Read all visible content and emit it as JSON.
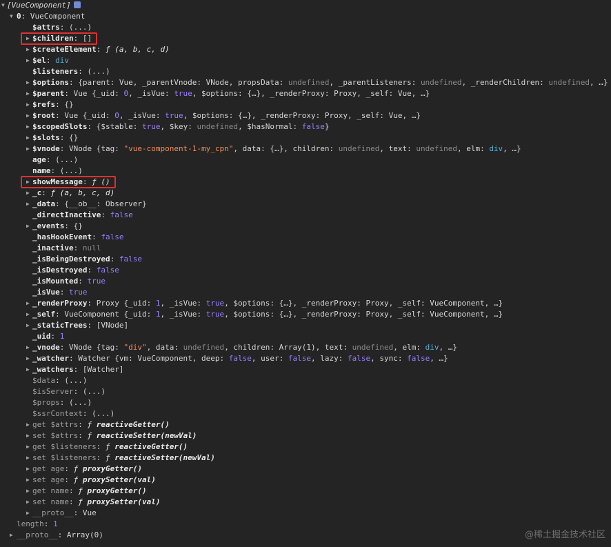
{
  "console": {
    "watermark": "@稀土掘金技术社区",
    "rows": [
      {
        "indent": 0,
        "arrow": "down",
        "parts": [
          {
            "t": "[VueComponent]",
            "c": "italic"
          },
          {
            "t": "",
            "c": "badge"
          }
        ]
      },
      {
        "indent": 1,
        "arrow": "down",
        "parts": [
          {
            "t": "0",
            "c": "k-own"
          },
          {
            "t": ": VueComponent",
            "c": ""
          }
        ]
      },
      {
        "indent": 2,
        "arrow": "",
        "parts": [
          {
            "t": "$attrs",
            "c": "k-own"
          },
          {
            "t": ": (...)",
            "c": ""
          }
        ]
      },
      {
        "indent": 2,
        "arrow": "right",
        "hl": "children",
        "parts": [
          {
            "t": "$children",
            "c": "k-own"
          },
          {
            "t": ": []",
            "c": ""
          }
        ]
      },
      {
        "indent": 2,
        "arrow": "right",
        "parts": [
          {
            "t": "$createElement",
            "c": "k-own"
          },
          {
            "t": ": ",
            "c": ""
          },
          {
            "t": "ƒ (a, b, c, d)",
            "c": "v-fn"
          }
        ]
      },
      {
        "indent": 2,
        "arrow": "right",
        "parts": [
          {
            "t": "$el",
            "c": "k-own"
          },
          {
            "t": ": ",
            "c": ""
          },
          {
            "t": "div",
            "c": "v-tag"
          }
        ]
      },
      {
        "indent": 2,
        "arrow": "",
        "parts": [
          {
            "t": "$listeners",
            "c": "k-own"
          },
          {
            "t": ": (...)",
            "c": ""
          }
        ]
      },
      {
        "indent": 2,
        "arrow": "right",
        "parts": [
          {
            "t": "$options",
            "c": "k-own"
          },
          {
            "t": ": {parent: Vue, _parentVnode: VNode, propsData: ",
            "c": ""
          },
          {
            "t": "undefined",
            "c": "v-undef"
          },
          {
            "t": ", _parentListeners: ",
            "c": ""
          },
          {
            "t": "undefined",
            "c": "v-undef"
          },
          {
            "t": ", _renderChildren: ",
            "c": ""
          },
          {
            "t": "undefined",
            "c": "v-undef"
          },
          {
            "t": ", …}",
            "c": ""
          }
        ]
      },
      {
        "indent": 2,
        "arrow": "right",
        "parts": [
          {
            "t": "$parent",
            "c": "k-own"
          },
          {
            "t": ": Vue {_uid: ",
            "c": ""
          },
          {
            "t": "0",
            "c": "v-num"
          },
          {
            "t": ", _isVue: ",
            "c": ""
          },
          {
            "t": "true",
            "c": "v-bool"
          },
          {
            "t": ", $options: {…}, _renderProxy: Proxy, _self: Vue, …}",
            "c": ""
          }
        ]
      },
      {
        "indent": 2,
        "arrow": "right",
        "parts": [
          {
            "t": "$refs",
            "c": "k-own"
          },
          {
            "t": ": {}",
            "c": ""
          }
        ]
      },
      {
        "indent": 2,
        "arrow": "right",
        "parts": [
          {
            "t": "$root",
            "c": "k-own"
          },
          {
            "t": ": Vue {_uid: ",
            "c": ""
          },
          {
            "t": "0",
            "c": "v-num"
          },
          {
            "t": ", _isVue: ",
            "c": ""
          },
          {
            "t": "true",
            "c": "v-bool"
          },
          {
            "t": ", $options: {…}, _renderProxy: Proxy, _self: Vue, …}",
            "c": ""
          }
        ]
      },
      {
        "indent": 2,
        "arrow": "right",
        "parts": [
          {
            "t": "$scopedSlots",
            "c": "k-own"
          },
          {
            "t": ": {$stable: ",
            "c": ""
          },
          {
            "t": "true",
            "c": "v-bool"
          },
          {
            "t": ", $key: ",
            "c": ""
          },
          {
            "t": "undefined",
            "c": "v-undef"
          },
          {
            "t": ", $hasNormal: ",
            "c": ""
          },
          {
            "t": "false",
            "c": "v-bool"
          },
          {
            "t": "}",
            "c": ""
          }
        ]
      },
      {
        "indent": 2,
        "arrow": "right",
        "parts": [
          {
            "t": "$slots",
            "c": "k-own"
          },
          {
            "t": ": {}",
            "c": ""
          }
        ]
      },
      {
        "indent": 2,
        "arrow": "right",
        "parts": [
          {
            "t": "$vnode",
            "c": "k-own"
          },
          {
            "t": ": VNode {tag: ",
            "c": ""
          },
          {
            "t": "\"vue-component-1-my_cpn\"",
            "c": "v-str"
          },
          {
            "t": ", data: {…}, children: ",
            "c": ""
          },
          {
            "t": "undefined",
            "c": "v-undef"
          },
          {
            "t": ", text: ",
            "c": ""
          },
          {
            "t": "undefined",
            "c": "v-undef"
          },
          {
            "t": ", elm: ",
            "c": ""
          },
          {
            "t": "div",
            "c": "v-tag"
          },
          {
            "t": ", …}",
            "c": ""
          }
        ]
      },
      {
        "indent": 2,
        "arrow": "",
        "parts": [
          {
            "t": "age",
            "c": "k-own"
          },
          {
            "t": ": (...)",
            "c": ""
          }
        ]
      },
      {
        "indent": 2,
        "arrow": "",
        "parts": [
          {
            "t": "name",
            "c": "k-own"
          },
          {
            "t": ": (...)",
            "c": ""
          }
        ]
      },
      {
        "indent": 2,
        "arrow": "right",
        "hl": "showMessage",
        "parts": [
          {
            "t": "showMessage",
            "c": "k-own"
          },
          {
            "t": ": ",
            "c": ""
          },
          {
            "t": "ƒ ()",
            "c": "v-fn"
          }
        ]
      },
      {
        "indent": 2,
        "arrow": "right",
        "parts": [
          {
            "t": "_c",
            "c": "k-own"
          },
          {
            "t": ": ",
            "c": ""
          },
          {
            "t": "ƒ (a, b, c, d)",
            "c": "v-fn"
          }
        ]
      },
      {
        "indent": 2,
        "arrow": "right",
        "parts": [
          {
            "t": "_data",
            "c": "k-own"
          },
          {
            "t": ": {__ob__: Observer}",
            "c": ""
          }
        ]
      },
      {
        "indent": 2,
        "arrow": "",
        "parts": [
          {
            "t": "_directInactive",
            "c": "k-own"
          },
          {
            "t": ": ",
            "c": ""
          },
          {
            "t": "false",
            "c": "v-bool"
          }
        ]
      },
      {
        "indent": 2,
        "arrow": "right",
        "parts": [
          {
            "t": "_events",
            "c": "k-own"
          },
          {
            "t": ": {}",
            "c": ""
          }
        ]
      },
      {
        "indent": 2,
        "arrow": "",
        "parts": [
          {
            "t": "_hasHookEvent",
            "c": "k-own"
          },
          {
            "t": ": ",
            "c": ""
          },
          {
            "t": "false",
            "c": "v-bool"
          }
        ]
      },
      {
        "indent": 2,
        "arrow": "",
        "parts": [
          {
            "t": "_inactive",
            "c": "k-own"
          },
          {
            "t": ": ",
            "c": ""
          },
          {
            "t": "null",
            "c": "v-null"
          }
        ]
      },
      {
        "indent": 2,
        "arrow": "",
        "parts": [
          {
            "t": "_isBeingDestroyed",
            "c": "k-own"
          },
          {
            "t": ": ",
            "c": ""
          },
          {
            "t": "false",
            "c": "v-bool"
          }
        ]
      },
      {
        "indent": 2,
        "arrow": "",
        "parts": [
          {
            "t": "_isDestroyed",
            "c": "k-own"
          },
          {
            "t": ": ",
            "c": ""
          },
          {
            "t": "false",
            "c": "v-bool"
          }
        ]
      },
      {
        "indent": 2,
        "arrow": "",
        "parts": [
          {
            "t": "_isMounted",
            "c": "k-own"
          },
          {
            "t": ": ",
            "c": ""
          },
          {
            "t": "true",
            "c": "v-bool"
          }
        ]
      },
      {
        "indent": 2,
        "arrow": "",
        "parts": [
          {
            "t": "_isVue",
            "c": "k-own"
          },
          {
            "t": ": ",
            "c": ""
          },
          {
            "t": "true",
            "c": "v-bool"
          }
        ]
      },
      {
        "indent": 2,
        "arrow": "right",
        "parts": [
          {
            "t": "_renderProxy",
            "c": "k-own"
          },
          {
            "t": ": Proxy {_uid: ",
            "c": ""
          },
          {
            "t": "1",
            "c": "v-num"
          },
          {
            "t": ", _isVue: ",
            "c": ""
          },
          {
            "t": "true",
            "c": "v-bool"
          },
          {
            "t": ", $options: {…}, _renderProxy: Proxy, _self: VueComponent, …}",
            "c": ""
          }
        ]
      },
      {
        "indent": 2,
        "arrow": "right",
        "parts": [
          {
            "t": "_self",
            "c": "k-own"
          },
          {
            "t": ": VueComponent {_uid: ",
            "c": ""
          },
          {
            "t": "1",
            "c": "v-num"
          },
          {
            "t": ", _isVue: ",
            "c": ""
          },
          {
            "t": "true",
            "c": "v-bool"
          },
          {
            "t": ", $options: {…}, _renderProxy: Proxy, _self: VueComponent, …}",
            "c": ""
          }
        ]
      },
      {
        "indent": 2,
        "arrow": "right",
        "parts": [
          {
            "t": "_staticTrees",
            "c": "k-own"
          },
          {
            "t": ": [VNode]",
            "c": ""
          }
        ]
      },
      {
        "indent": 2,
        "arrow": "",
        "parts": [
          {
            "t": "_uid",
            "c": "k-own"
          },
          {
            "t": ": ",
            "c": ""
          },
          {
            "t": "1",
            "c": "v-num"
          }
        ]
      },
      {
        "indent": 2,
        "arrow": "right",
        "parts": [
          {
            "t": "_vnode",
            "c": "k-own"
          },
          {
            "t": ": VNode {tag: ",
            "c": ""
          },
          {
            "t": "\"div\"",
            "c": "v-str"
          },
          {
            "t": ", data: ",
            "c": ""
          },
          {
            "t": "undefined",
            "c": "v-undef"
          },
          {
            "t": ", children: Array(1), text: ",
            "c": ""
          },
          {
            "t": "undefined",
            "c": "v-undef"
          },
          {
            "t": ", elm: ",
            "c": ""
          },
          {
            "t": "div",
            "c": "v-tag"
          },
          {
            "t": ", …}",
            "c": ""
          }
        ]
      },
      {
        "indent": 2,
        "arrow": "right",
        "parts": [
          {
            "t": "_watcher",
            "c": "k-own"
          },
          {
            "t": ": Watcher {vm: VueComponent, deep: ",
            "c": ""
          },
          {
            "t": "false",
            "c": "v-bool"
          },
          {
            "t": ", user: ",
            "c": ""
          },
          {
            "t": "false",
            "c": "v-bool"
          },
          {
            "t": ", lazy: ",
            "c": ""
          },
          {
            "t": "false",
            "c": "v-bool"
          },
          {
            "t": ", sync: ",
            "c": ""
          },
          {
            "t": "false",
            "c": "v-bool"
          },
          {
            "t": ", …}",
            "c": ""
          }
        ]
      },
      {
        "indent": 2,
        "arrow": "right",
        "parts": [
          {
            "t": "_watchers",
            "c": "k-own"
          },
          {
            "t": ": [Watcher]",
            "c": ""
          }
        ]
      },
      {
        "indent": 2,
        "arrow": "",
        "parts": [
          {
            "t": "$data",
            "c": "k-inh"
          },
          {
            "t": ": (...)",
            "c": ""
          }
        ]
      },
      {
        "indent": 2,
        "arrow": "",
        "parts": [
          {
            "t": "$isServer",
            "c": "k-inh"
          },
          {
            "t": ": (...)",
            "c": ""
          }
        ]
      },
      {
        "indent": 2,
        "arrow": "",
        "parts": [
          {
            "t": "$props",
            "c": "k-inh"
          },
          {
            "t": ": (...)",
            "c": ""
          }
        ]
      },
      {
        "indent": 2,
        "arrow": "",
        "parts": [
          {
            "t": "$ssrContext",
            "c": "k-inh"
          },
          {
            "t": ": (...)",
            "c": ""
          }
        ]
      },
      {
        "indent": 2,
        "arrow": "right",
        "parts": [
          {
            "t": "get $attrs",
            "c": "k-inh"
          },
          {
            "t": ": ",
            "c": ""
          },
          {
            "t": "ƒ ",
            "c": "v-fn"
          },
          {
            "t": "reactiveGetter()",
            "c": "v-fnname"
          }
        ]
      },
      {
        "indent": 2,
        "arrow": "right",
        "parts": [
          {
            "t": "set $attrs",
            "c": "k-inh"
          },
          {
            "t": ": ",
            "c": ""
          },
          {
            "t": "ƒ ",
            "c": "v-fn"
          },
          {
            "t": "reactiveSetter(newVal)",
            "c": "v-fnname"
          }
        ]
      },
      {
        "indent": 2,
        "arrow": "right",
        "parts": [
          {
            "t": "get $listeners",
            "c": "k-inh"
          },
          {
            "t": ": ",
            "c": ""
          },
          {
            "t": "ƒ ",
            "c": "v-fn"
          },
          {
            "t": "reactiveGetter()",
            "c": "v-fnname"
          }
        ]
      },
      {
        "indent": 2,
        "arrow": "right",
        "parts": [
          {
            "t": "set $listeners",
            "c": "k-inh"
          },
          {
            "t": ": ",
            "c": ""
          },
          {
            "t": "ƒ ",
            "c": "v-fn"
          },
          {
            "t": "reactiveSetter(newVal)",
            "c": "v-fnname"
          }
        ]
      },
      {
        "indent": 2,
        "arrow": "right",
        "parts": [
          {
            "t": "get age",
            "c": "k-inh"
          },
          {
            "t": ": ",
            "c": ""
          },
          {
            "t": "ƒ ",
            "c": "v-fn"
          },
          {
            "t": "proxyGetter()",
            "c": "v-fnname"
          }
        ]
      },
      {
        "indent": 2,
        "arrow": "right",
        "parts": [
          {
            "t": "set age",
            "c": "k-inh"
          },
          {
            "t": ": ",
            "c": ""
          },
          {
            "t": "ƒ ",
            "c": "v-fn"
          },
          {
            "t": "proxySetter(val)",
            "c": "v-fnname"
          }
        ]
      },
      {
        "indent": 2,
        "arrow": "right",
        "parts": [
          {
            "t": "get name",
            "c": "k-inh"
          },
          {
            "t": ": ",
            "c": ""
          },
          {
            "t": "ƒ ",
            "c": "v-fn"
          },
          {
            "t": "proxyGetter()",
            "c": "v-fnname"
          }
        ]
      },
      {
        "indent": 2,
        "arrow": "right",
        "parts": [
          {
            "t": "set name",
            "c": "k-inh"
          },
          {
            "t": ": ",
            "c": ""
          },
          {
            "t": "ƒ ",
            "c": "v-fn"
          },
          {
            "t": "proxySetter(val)",
            "c": "v-fnname"
          }
        ]
      },
      {
        "indent": 2,
        "arrow": "right",
        "parts": [
          {
            "t": "__proto__",
            "c": "k-inh"
          },
          {
            "t": ": Vue",
            "c": ""
          }
        ]
      },
      {
        "indent": 1,
        "arrow": "",
        "parts": [
          {
            "t": "length",
            "c": "k-inh"
          },
          {
            "t": ": ",
            "c": ""
          },
          {
            "t": "1",
            "c": "v-num"
          }
        ]
      },
      {
        "indent": 1,
        "arrow": "right",
        "parts": [
          {
            "t": "__proto__",
            "c": "k-inh"
          },
          {
            "t": ": Array(0)",
            "c": ""
          }
        ]
      }
    ]
  }
}
